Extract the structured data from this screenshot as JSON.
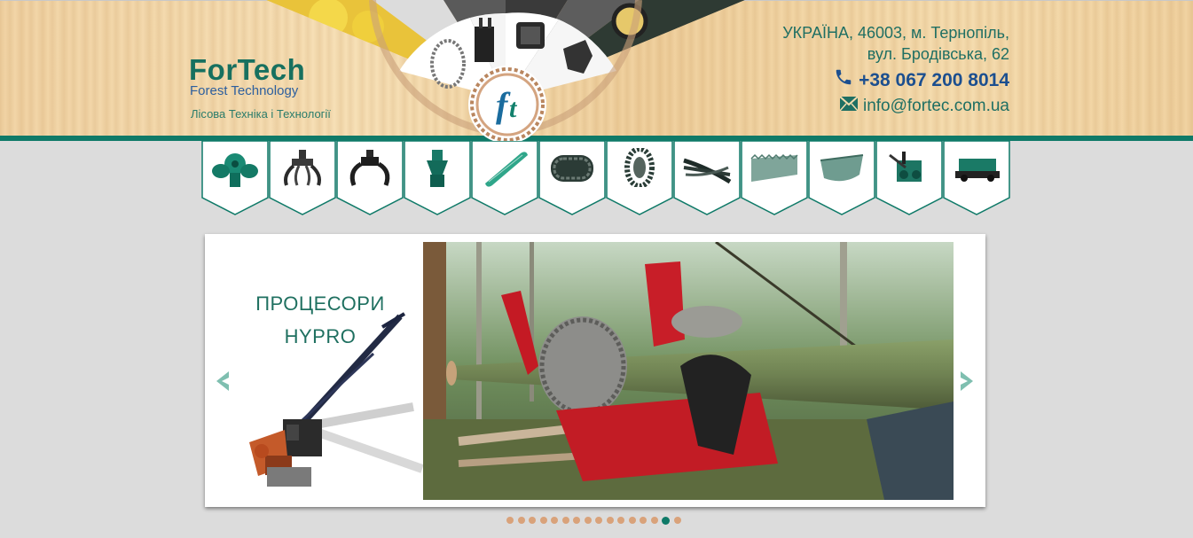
{
  "brand": {
    "name": "ForTech",
    "subtitle": "Forest Technology",
    "tagline": "Лісова Техніка і Технології"
  },
  "contacts": {
    "address_line1": "УКРАЇНА, 46003, м. Тернопіль,",
    "address_line2": "вул. Бродівська, 62",
    "phone": "+38 067 200 8014",
    "email": "info@fortec.com.ua",
    "phone_icon": "phone-icon",
    "email_icon": "envelope-icon"
  },
  "nav": {
    "items": [
      {
        "icon": "rotator-icon"
      },
      {
        "icon": "grapple-icon"
      },
      {
        "icon": "log-grapple-icon"
      },
      {
        "icon": "rotator-link-icon"
      },
      {
        "icon": "saw-bar-icon"
      },
      {
        "icon": "track-icon"
      },
      {
        "icon": "tire-chain-icon"
      },
      {
        "icon": "hose-icon"
      },
      {
        "icon": "saw-chain-icon"
      },
      {
        "icon": "bucket-icon"
      },
      {
        "icon": "processor-icon"
      },
      {
        "icon": "trailer-icon"
      }
    ]
  },
  "slider": {
    "title_line1": "ПРОЦЕСОРИ",
    "title_line2": "HYPRO",
    "slide_count": 16,
    "active_index": 14
  },
  "colors": {
    "brand_green": "#0f7a68",
    "brand_blue": "#2d5f9e",
    "dot_inactive": "#d9a27a",
    "dot_active": "#0f7a68"
  }
}
